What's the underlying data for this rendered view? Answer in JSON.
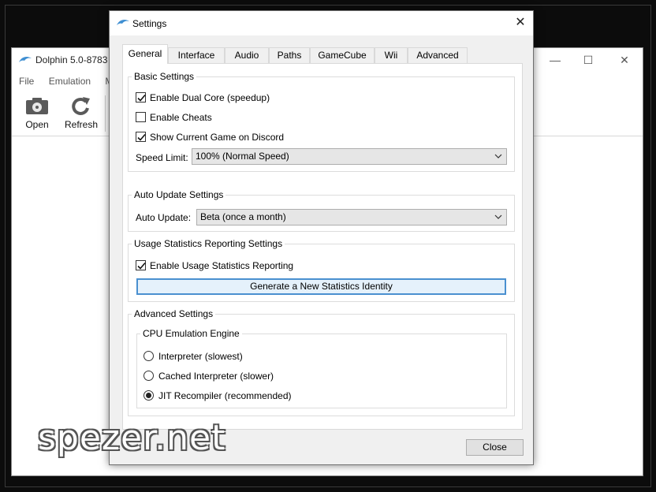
{
  "main_window": {
    "title": "Dolphin 5.0-8783",
    "menu": [
      "File",
      "Emulation",
      "M"
    ],
    "toolbar": {
      "open_label": "Open",
      "refresh_label": "Refresh"
    },
    "controls": {
      "minimize": "—",
      "maximize": "☐",
      "close": "✕"
    }
  },
  "dialog": {
    "title": "Settings",
    "close_glyph": "✕",
    "tabs": [
      "General",
      "Interface",
      "Audio",
      "Paths",
      "GameCube",
      "Wii",
      "Advanced"
    ],
    "active_tab": "General",
    "basic": {
      "title": "Basic Settings",
      "dual_core": {
        "label": "Enable Dual Core (speedup)",
        "checked": true
      },
      "cheats": {
        "label": "Enable Cheats",
        "checked": false
      },
      "discord": {
        "label": "Show Current Game on Discord",
        "checked": true
      },
      "speed_limit": {
        "label": "Speed Limit:",
        "value": "100% (Normal Speed)"
      }
    },
    "auto_update": {
      "title": "Auto Update Settings",
      "label": "Auto Update:",
      "value": "Beta (once a month)"
    },
    "usage": {
      "title": "Usage Statistics Reporting Settings",
      "enable": {
        "label": "Enable Usage Statistics Reporting",
        "checked": true
      },
      "generate_button": "Generate a New Statistics Identity"
    },
    "advanced": {
      "title": "Advanced Settings",
      "cpu_engine": {
        "title": "CPU Emulation Engine",
        "options": [
          "Interpreter (slowest)",
          "Cached Interpreter (slower)",
          "JIT Recompiler (recommended)"
        ],
        "selected": "JIT Recompiler (recommended)"
      }
    },
    "close_button": "Close"
  },
  "watermark": "spezer.net",
  "colors": {
    "focus_border": "#4a90d0",
    "dialog_bg": "#f0f0f0",
    "backdrop": "#0c0c0c"
  }
}
